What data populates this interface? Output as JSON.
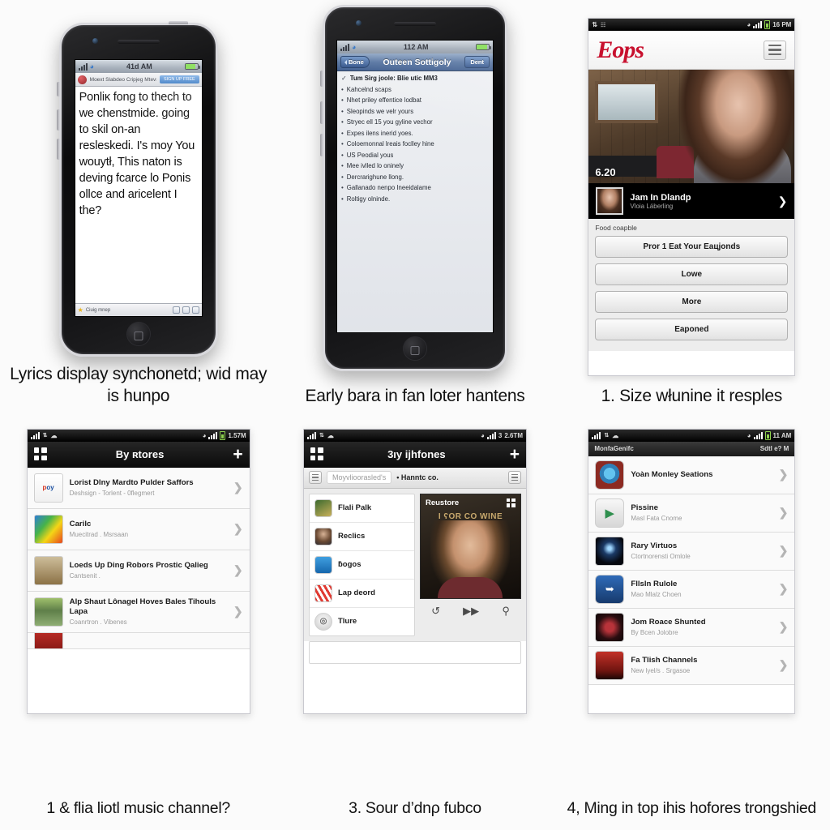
{
  "panels": [
    {
      "id": "lyrics-phone",
      "caption": "Lyrics display synchonetd; wid may is hunpo",
      "status": {
        "time": "41d AM",
        "signal": "signal-bars",
        "wifi": "wifi-icon",
        "battery": "battery-icon"
      },
      "app_bar": {
        "icon": "app-badge-icon",
        "subtitle": "Moext Slabdeo Cripjeg Mtevs",
        "pill": "SIGN UP FREE"
      },
      "lyrics": "Ponliĸ fong to thech to we chenstmide. going to skil on-an resleskedi. I's moy You wouytł, This naton is deving fcarce lo Ponis ollce and aricelent I the?",
      "footer": {
        "star": "star-icon",
        "label": "Ciuig mnep",
        "icons": [
          "share-icon",
          "refresh-icon",
          "book-icon"
        ]
      }
    },
    {
      "id": "outline-phone",
      "caption": "Early bara in fan loter hantens",
      "status": {
        "time": "112 AM"
      },
      "nav": {
        "back": "Bone",
        "title": "Outeen Sottigoly",
        "right": "Dent"
      },
      "items": [
        {
          "bullet": "check",
          "text": "Tum Sirg joole: Blie utic MM3"
        },
        {
          "bullet": "dot",
          "text": "Kahcelnd scaps"
        },
        {
          "bullet": "dot",
          "text": "Nhet priley effentice lodbat"
        },
        {
          "bullet": "dot",
          "text": "Sleopinds we velr yours"
        },
        {
          "bullet": "dot",
          "text": "Stryec ell 15 you gyline vechor"
        },
        {
          "bullet": "dot",
          "text": "Expes ilens inerid yoes."
        },
        {
          "bullet": "dot",
          "text": "Coloemonnal lreais foclley hine"
        },
        {
          "bullet": "dot",
          "text": "US Peodial yous"
        },
        {
          "bullet": "dot",
          "text": "Mee ivlled lo oninely"
        },
        {
          "bullet": "dot",
          "text": "Dercrarighune llong."
        },
        {
          "bullet": "dot",
          "text": "Gallanado nenpo Ineeidalame"
        },
        {
          "bullet": "dot",
          "text": "Roltigy olninde."
        }
      ],
      "buttons": {
        "left": "music-note-icon",
        "right": "info-icon"
      }
    },
    {
      "id": "eops-app",
      "caption": "1. Size włunine it resples",
      "status": {
        "left": "carrier-label",
        "time": "16 PM"
      },
      "header": {
        "logo": "Eops",
        "menu": "hamburger-icon"
      },
      "hero": {
        "duration": "6.20",
        "image": "woman-on-phone-photo"
      },
      "featured": {
        "title": "Jam In Dlandp",
        "subtitle": "Vloia Láberling",
        "chevron": "chevron-right-icon"
      },
      "section_label": "Food coapble",
      "buttons": [
        "Pror 1 Eat Your Eaцjonds",
        "Lowe",
        "More",
        "Eaponed"
      ]
    },
    {
      "id": "stores-list",
      "caption": "1 & flia liotl music channel?",
      "status": {
        "time": "1.57M"
      },
      "bar": {
        "left": "grid-icon",
        "title": "By ʀtores",
        "right": "plus-icon"
      },
      "rows": [
        {
          "title": "Lorist Dlny Mardto Pulder Saffors",
          "sub": "Deshsign - Torlent - 0flegmert",
          "thumb": "popay-logo"
        },
        {
          "title": "Carilc",
          "sub": "Muecitrad . Msrsaan",
          "thumb": "rainbow-art"
        },
        {
          "title": "Loeds Up Ding Robors Prostic Qalieg",
          "sub": "Cantsenit .",
          "thumb": "poster-art"
        },
        {
          "title": "Alp Shaut Lônagel Hoves Bales Tihouls Lapa",
          "sub": "Coanrtron . Vibenes",
          "thumb": "people-photo"
        }
      ]
    },
    {
      "id": "media-browser",
      "caption": "3. Sour d’dnρ fubco",
      "status": {
        "time": "2.6TM"
      },
      "bar": {
        "left": "grid-icon",
        "title": "3ıy ĳhfones",
        "right": "plus-icon"
      },
      "toolbar": {
        "menu_left": "list-icon",
        "search_placeholder": "Moyvlioorasled's",
        "crumb": "• Hanntc co.",
        "menu_right": "menu-icon"
      },
      "list": [
        {
          "label": "Flali Palk",
          "icon": "album-icon"
        },
        {
          "label": "Reclics",
          "icon": "portrait-icon"
        },
        {
          "label": "ƃogos",
          "icon": "blue-app-icon"
        },
        {
          "label": "Lap deord",
          "icon": "red-stripe-icon"
        },
        {
          "label": "Tlure",
          "icon": "more-circle-icon"
        }
      ],
      "art": {
        "label": "Reustore",
        "title": "I ʕOR CO WINE",
        "dots": "grid-dots-icon"
      },
      "controls": [
        "repeat-icon",
        "fast-forward-icon",
        "search-circle-icon"
      ]
    },
    {
      "id": "channels-list",
      "caption": "4, Ming in top ihis hofores trongshied",
      "status": {
        "time": "11 AM"
      },
      "subbar": {
        "left": "MonfaGenifc",
        "right": "Sdtl e? M"
      },
      "rows": [
        {
          "title": "Yoàn Monley Seations",
          "sub": "",
          "thumb": "target-icon"
        },
        {
          "title": "Pissine",
          "sub": "Masl Fata Cnome",
          "thumb": "play-icon"
        },
        {
          "title": "Rary Virtuos",
          "sub": "Ctortnorensti Omlole",
          "thumb": "stage-photo"
        },
        {
          "title": "Fllsln Rulole",
          "sub": "Mao Mlalz Choen",
          "thumb": "blue-arrow-icon"
        },
        {
          "title": "Jom Roace Shunted",
          "sub": "By Bcen Jolobre",
          "thumb": "dark-badge-icon"
        },
        {
          "title": "Fa Tlish Channels",
          "sub": "New lyel/s . Srgasoe",
          "thumb": "red-poster-icon"
        }
      ]
    }
  ]
}
